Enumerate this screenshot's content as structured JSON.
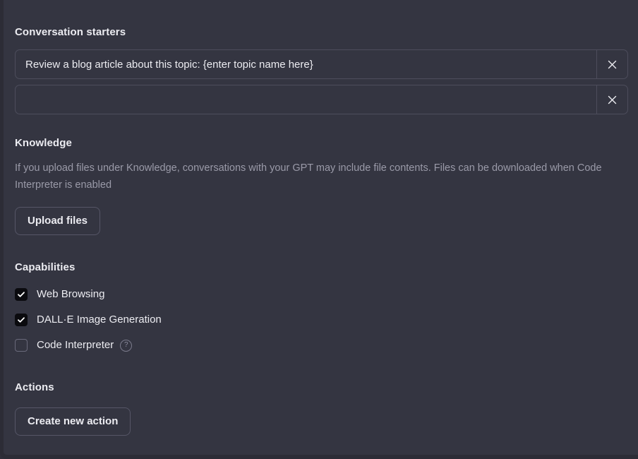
{
  "conversation_starters": {
    "title": "Conversation starters",
    "clear_icon": "close-icon",
    "rows": [
      {
        "value": "Review a blog article about this topic: {enter topic name here}",
        "placeholder": ""
      },
      {
        "value": "",
        "placeholder": ""
      }
    ]
  },
  "knowledge": {
    "title": "Knowledge",
    "description": "If you upload files under Knowledge, conversations with your GPT may include file contents. Files can be downloaded when Code Interpreter is enabled",
    "upload_label": "Upload files"
  },
  "capabilities": {
    "title": "Capabilities",
    "items": [
      {
        "label": "Web Browsing",
        "checked": true,
        "help": false
      },
      {
        "label": "DALL·E Image Generation",
        "checked": true,
        "help": false
      },
      {
        "label": "Code Interpreter",
        "checked": false,
        "help": true,
        "help_glyph": "?"
      }
    ]
  },
  "actions": {
    "title": "Actions",
    "create_label": "Create new action"
  },
  "colors": {
    "panel_background": "#343541",
    "page_background": "#2f2f3a",
    "edge": "#2c2c36",
    "border": "#4d4d5c",
    "text_primary": "#ececf1",
    "text_muted": "#9a9aa8",
    "checkbox_checked": "#0b0b0f"
  }
}
